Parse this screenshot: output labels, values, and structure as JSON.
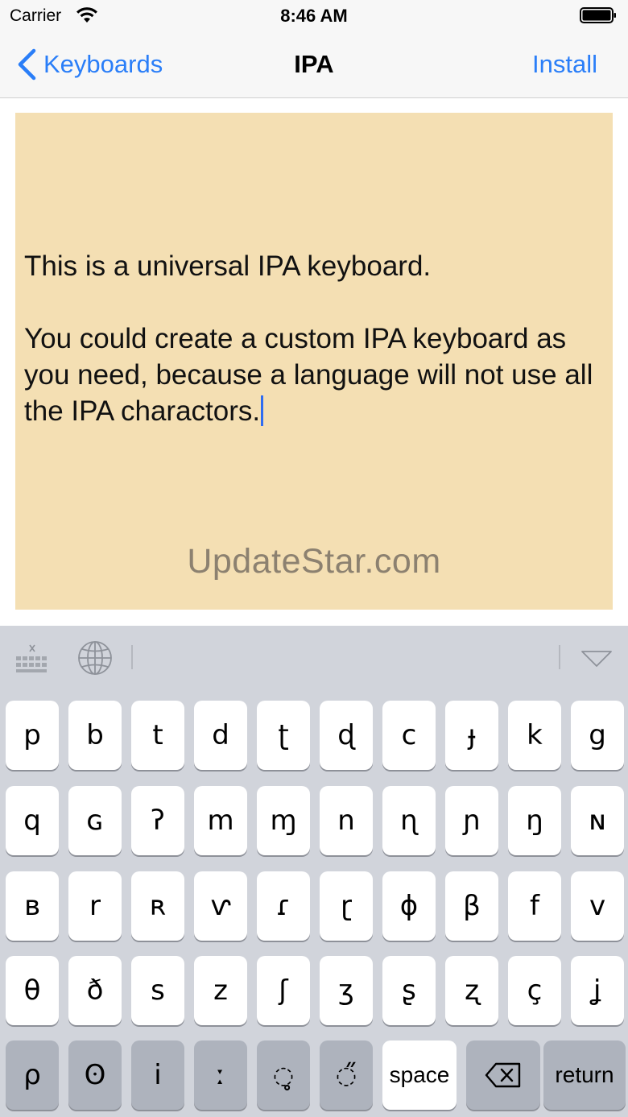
{
  "status_bar": {
    "carrier": "Carrier",
    "time": "8:46 AM"
  },
  "nav": {
    "back_label": "Keyboards",
    "title": "IPA",
    "action_label": "Install"
  },
  "editor": {
    "line1": "This is a universal IPA keyboard.",
    "line2": "You could create a custom IPA keyboard as you need, because a language will not use all the IPA charactors.",
    "background": "#f4dfb3",
    "cursor_color": "#2f6cf0"
  },
  "watermark": "UpdateStar.com",
  "keyboard": {
    "toolbar_icons": [
      "keyboard-hide-icon",
      "globe-icon",
      "dismiss-keyboard-icon"
    ],
    "rows": [
      [
        "p",
        "b",
        "t",
        "d",
        "ʈ",
        "ɖ",
        "c",
        "ɟ",
        "k",
        "g"
      ],
      [
        "q",
        "ɢ",
        "ʔ",
        "m",
        "ɱ",
        "n",
        "ɳ",
        "ɲ",
        "ŋ",
        "ɴ"
      ],
      [
        "ʙ",
        "r",
        "ʀ",
        "ⱱ",
        "ɾ",
        "ɽ",
        "ɸ",
        "β",
        "f",
        "v"
      ],
      [
        "θ",
        "ð",
        "s",
        "z",
        "ʃ",
        "ʒ",
        "ʂ",
        "ʐ",
        "ç",
        "ʝ"
      ]
    ],
    "bottom_row": {
      "dark_keys": [
        "ρ",
        "ʘ",
        "i",
        "ː",
        "̥",
        "̋"
      ],
      "space_label": "space",
      "delete_icon": "delete-backspace-icon",
      "return_label": "return"
    },
    "accent_color": "#2a7ef8"
  }
}
